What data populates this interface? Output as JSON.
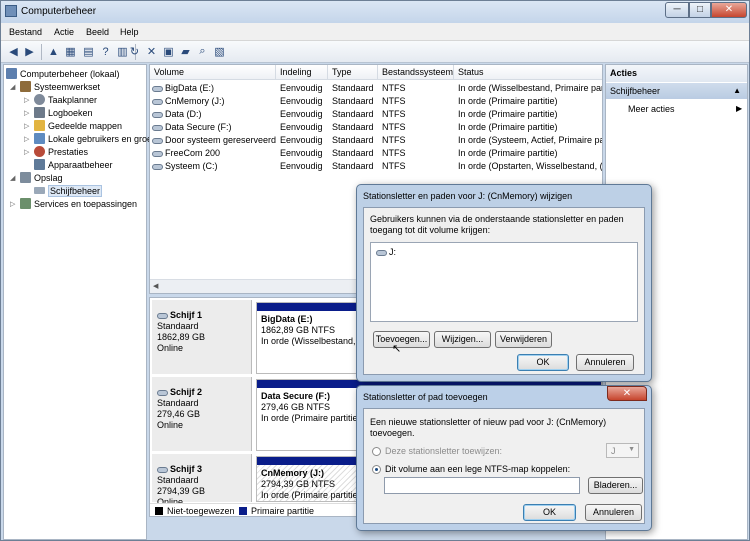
{
  "window": {
    "title": "Computerbeheer",
    "minimize": "─",
    "maximize": "□",
    "close": "✕"
  },
  "menu": [
    "Bestand",
    "Actie",
    "Beeld",
    "Help"
  ],
  "tree": [
    {
      "label": "Computerbeheer (lokaal)",
      "icon": "computer-icon",
      "color": "#5d7fae"
    },
    {
      "label": "Systeemwerkset",
      "icon": "tools-icon",
      "color": "#8e6b3a"
    },
    {
      "label": "Taakplanner",
      "icon": "clock-icon",
      "color": "#7f8a9a"
    },
    {
      "label": "Logboeken",
      "icon": "log-icon",
      "color": "#6d7a8a"
    },
    {
      "label": "Gedeelde mappen",
      "icon": "folder-icon",
      "color": "#e2b441"
    },
    {
      "label": "Lokale gebruikers en groepen",
      "icon": "users-icon",
      "color": "#5e8bc0"
    },
    {
      "label": "Prestaties",
      "icon": "performance-icon",
      "color": "#b84b3a"
    },
    {
      "label": "Apparaatbeheer",
      "icon": "device-icon",
      "color": "#5f7a99"
    },
    {
      "label": "Opslag",
      "icon": "storage-icon",
      "color": "#7d8c9c"
    },
    {
      "label": "Schijfbeheer",
      "icon": "disk-icon",
      "color": "#9aa8b8"
    },
    {
      "label": "Services en toepassingen",
      "icon": "services-icon",
      "color": "#6b8f6b"
    }
  ],
  "volumes": {
    "headers": [
      "Volume",
      "Indeling",
      "Type",
      "Bestandssysteem",
      "Status"
    ],
    "rows": [
      [
        "BigData (E:)",
        "Eenvoudig",
        "Standaard",
        "NTFS",
        "In orde (Wisselbestand, Primaire par"
      ],
      [
        "CnMemory (J:)",
        "Eenvoudig",
        "Standaard",
        "NTFS",
        "In orde (Primaire partitie)"
      ],
      [
        "Data (D:)",
        "Eenvoudig",
        "Standaard",
        "NTFS",
        "In orde (Primaire partitie)"
      ],
      [
        "Data Secure (F:)",
        "Eenvoudig",
        "Standaard",
        "NTFS",
        "In orde (Primaire partitie)"
      ],
      [
        "Door systeem gereserveerd",
        "Eenvoudig",
        "Standaard",
        "NTFS",
        "In orde (Systeem, Actief, Primaire pa"
      ],
      [
        "FreeCom 200",
        "Eenvoudig",
        "Standaard",
        "NTFS",
        "In orde (Primaire partitie)"
      ],
      [
        "Systeem (C:)",
        "Eenvoudig",
        "Standaard",
        "NTFS",
        "In orde (Opstarten, Wisselbestand, ("
      ]
    ]
  },
  "disks": [
    {
      "name": "Schijf 1",
      "type": "Standaard",
      "size": "1862,89 GB",
      "state": "Online",
      "part_name": "BigData  (E:)",
      "part_size": "1862,89 GB NTFS",
      "part_status": "In orde (Wisselbestand, Pri"
    },
    {
      "name": "Schijf 2",
      "type": "Standaard",
      "size": "279,46 GB",
      "state": "Online",
      "part_name": "Data Secure  (F:)",
      "part_size": "279,46 GB NTFS",
      "part_status": "In orde (Primaire partitie)"
    },
    {
      "name": "Schijf 3",
      "type": "Standaard",
      "size": "2794,39 GB",
      "state": "Online",
      "part_name": "CnMemory  (J:)",
      "part_size": "2794,39 GB NTFS",
      "part_status": "In orde (Primaire partitie)"
    }
  ],
  "legend": {
    "unallocated": "Niet-toegewezen",
    "primary": "Primaire partitie"
  },
  "actions": {
    "header": "Acties",
    "section": "Schijfbeheer",
    "more": "Meer acties"
  },
  "dialog1": {
    "title": "Stationsletter en paden voor J: (CnMemory) wijzigen",
    "description": "Gebruikers kunnen via de onderstaande stationsletter en paden toegang tot dit volume krijgen:",
    "list_item": "J:",
    "add": "Toevoegen...",
    "change": "Wijzigen...",
    "remove": "Verwijderen",
    "ok": "OK",
    "cancel": "Annuleren"
  },
  "dialog2": {
    "title": "Stationsletter of pad toevoegen",
    "description": "Een nieuwe stationsletter of nieuw pad voor J: (CnMemory) toevoegen.",
    "option1": "Deze stationsletter toewijzen:",
    "drive_letter": "J",
    "option2": "Dit volume aan een lege NTFS-map koppelen:",
    "path_value": "",
    "browse": "Bladeren...",
    "ok": "OK",
    "cancel": "Annuleren"
  },
  "colors": {
    "primary_partition": "#0a1d8a",
    "unallocated": "#000000",
    "window_frame": "#c9d8ea"
  }
}
